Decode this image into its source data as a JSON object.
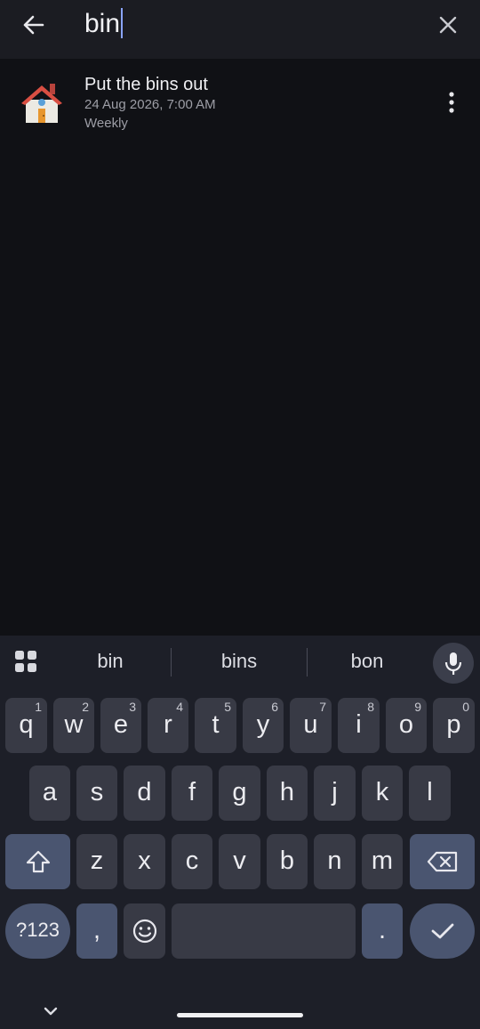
{
  "search": {
    "query": "bin"
  },
  "results": [
    {
      "title": "Put the bins out",
      "date": "24 Aug 2026, 7:00 AM",
      "repeat": "Weekly",
      "icon": "house-icon"
    }
  ],
  "keyboard": {
    "suggestions": [
      "bin",
      "bins",
      "bon"
    ],
    "row1": [
      {
        "k": "q",
        "h": "1"
      },
      {
        "k": "w",
        "h": "2"
      },
      {
        "k": "e",
        "h": "3"
      },
      {
        "k": "r",
        "h": "4"
      },
      {
        "k": "t",
        "h": "5"
      },
      {
        "k": "y",
        "h": "6"
      },
      {
        "k": "u",
        "h": "7"
      },
      {
        "k": "i",
        "h": "8"
      },
      {
        "k": "o",
        "h": "9"
      },
      {
        "k": "p",
        "h": "0"
      }
    ],
    "row2": [
      "a",
      "s",
      "d",
      "f",
      "g",
      "h",
      "j",
      "k",
      "l"
    ],
    "row3": [
      "z",
      "x",
      "c",
      "v",
      "b",
      "n",
      "m"
    ],
    "symbols_label": "?123",
    "comma": ",",
    "period": "."
  },
  "colors": {
    "background": "#101115",
    "keyboard": "#1d1f28",
    "key": "#383a45",
    "func_key": "#4a5570",
    "accent_caret": "#8aa4ff"
  }
}
